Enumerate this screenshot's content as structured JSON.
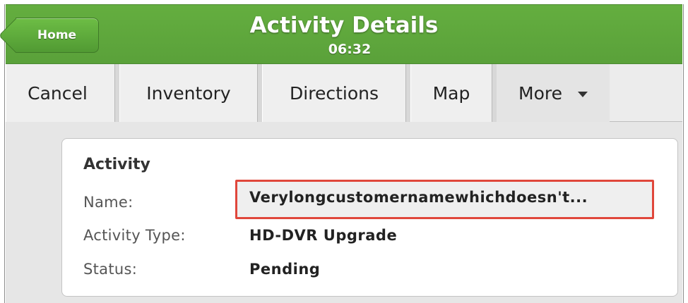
{
  "header": {
    "home_label": "Home",
    "title": "Activity Details",
    "time": "06:32"
  },
  "toolbar": {
    "cancel": "Cancel",
    "inventory": "Inventory",
    "directions": "Directions",
    "map": "Map",
    "more": "More"
  },
  "activity": {
    "section_title": "Activity",
    "name_label": "Name:",
    "name_value": "Verylongcustomernamewhichdoesn't...",
    "type_label": "Activity Type:",
    "type_value": "HD-DVR Upgrade",
    "status_label": "Status:",
    "status_value": "Pending"
  },
  "colors": {
    "header_green": "#5aa13a",
    "highlight_red": "#e0473b"
  }
}
